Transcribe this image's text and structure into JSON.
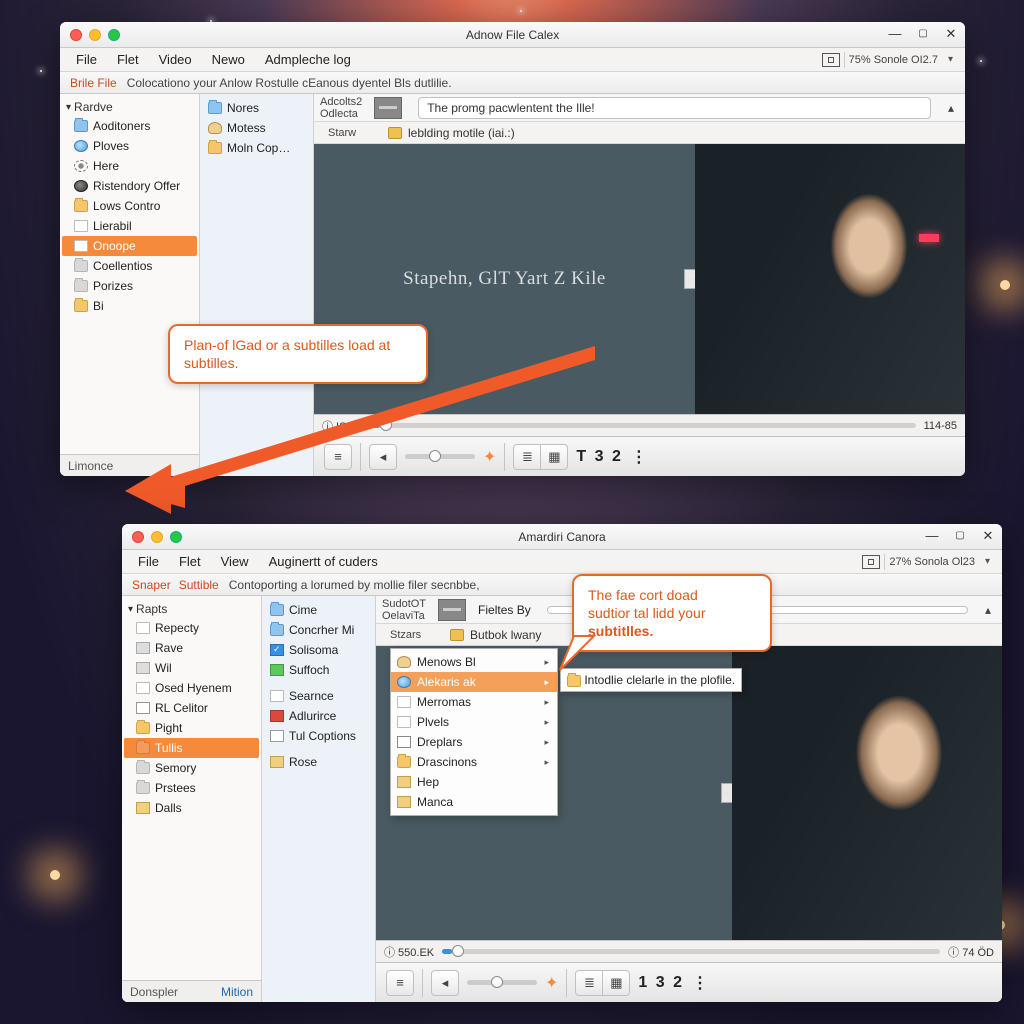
{
  "win1": {
    "title": "Adnow File Calex",
    "menus": [
      "File",
      "Flet",
      "Video",
      "Newo",
      "Admpleche log"
    ],
    "battery": "75% Sonole OI2.7",
    "toolbar2": {
      "link": "Brile File",
      "desc": "Colocationo your Anlow Rostulle cEanous dyentel Bls dutlilie."
    },
    "sidebar": {
      "header": "Rardve",
      "items": [
        {
          "icon": "folder blue",
          "label": "Aoditoners"
        },
        {
          "icon": "globe",
          "label": "Ploves"
        },
        {
          "icon": "gear",
          "label": "Here"
        },
        {
          "icon": "darkglobe",
          "label": "Ristendory Offer"
        },
        {
          "icon": "folder",
          "label": "Lows Contro"
        },
        {
          "icon": "page",
          "label": "Lierabil"
        },
        {
          "icon": "page",
          "label": "Onoope",
          "selected": true
        },
        {
          "icon": "folder grey",
          "label": "Coellentios"
        },
        {
          "icon": "folder grey",
          "label": "Porizes"
        },
        {
          "icon": "folder",
          "label": "Bi"
        }
      ],
      "status": "Limonce"
    },
    "midcol": [
      {
        "icon": "folder blue",
        "label": "Nores"
      },
      {
        "icon": "person",
        "label": "Motess"
      },
      {
        "icon": "folder",
        "label": "Moln Cop…"
      }
    ],
    "info": {
      "lines": [
        "Adcolts2",
        "Odlecta",
        "Starw"
      ],
      "message": "The promg pacwlentent the Ille!",
      "subline": "leblding motile (iai.:)"
    },
    "overlay_text": "Stapehn, GlT Yart Z Kile",
    "seek": {
      "left_time": "ⓘ IS6O",
      "pos_pct": 2,
      "right_time": "114-85"
    },
    "counter": "T 3 2"
  },
  "win2": {
    "title": "Amardiri Canora",
    "menus": [
      "File",
      "Flet",
      "View",
      "Auginertt of cuders"
    ],
    "battery": "27% Sonola Ol23",
    "toolbar2": {
      "link1": "Snaper",
      "link2": "Suttible",
      "desc": "Contoporting a lorumed by mollie filer secnbbe,"
    },
    "sidebar": {
      "header": "Rapts",
      "items": [
        {
          "icon": "page",
          "label": "Repecty"
        },
        {
          "icon": "disk",
          "label": "Rave"
        },
        {
          "icon": "disk",
          "label": "Wil"
        },
        {
          "icon": "page",
          "label": "Osed Hyenem"
        },
        {
          "icon": "text",
          "label": "RL Celitor"
        },
        {
          "icon": "folder",
          "label": "Pight"
        },
        {
          "icon": "folder orange",
          "label": "Tullis",
          "selected": true
        },
        {
          "icon": "folder grey",
          "label": "Semory"
        },
        {
          "icon": "folder grey",
          "label": "Prstees"
        },
        {
          "icon": "pic",
          "label": "Dalls"
        }
      ],
      "status": "Donspler",
      "status_right": "Mition"
    },
    "midcol": [
      {
        "icon": "folder blue",
        "label": "Cime"
      },
      {
        "icon": "folder blue",
        "label": "Concrher Mi"
      },
      {
        "icon": "bluecheck",
        "label": "Solisoma"
      },
      {
        "icon": "green",
        "label": "Suffoch"
      },
      {
        "icon": "page",
        "label": "Searnce"
      },
      {
        "icon": "red",
        "label": "Adlurirce"
      },
      {
        "icon": "text",
        "label": "Tul Coptions"
      },
      {
        "icon": "pic",
        "label": "Rose"
      }
    ],
    "info": {
      "lines": [
        "SudotOT",
        "OelaviTa",
        "Stzars"
      ],
      "message_prefix": "Fieltes By",
      "subline": "Butbok lwany"
    },
    "context_menu": [
      {
        "icon": "person",
        "label": "Menows Bl",
        "arrow": true
      },
      {
        "icon": "globe",
        "label": "Alekaris ak",
        "arrow": true,
        "selected": true
      },
      {
        "icon": "page",
        "label": "Merromas",
        "arrow": true
      },
      {
        "icon": "page",
        "label": "Plvels",
        "arrow": true
      },
      {
        "icon": "sub",
        "label": "Dreplars",
        "arrow": true
      },
      {
        "icon": "folder",
        "label": "Drascinons",
        "arrow": true
      },
      {
        "icon": "pic",
        "label": "Hep"
      },
      {
        "icon": "pic",
        "label": "Manca"
      }
    ],
    "submenu_text": "Intodlie clelarle in the plofile.",
    "seek": {
      "left_time": "ⓘ 550.EK",
      "pos_pct": 2,
      "right_time": "ⓘ 74 ÖD"
    },
    "counter": "1 3 2"
  },
  "callout1": "Plan-of lGad or a subtilles load at subtilles.",
  "callout2_lines": [
    "The fae cort doad",
    "sudtior tal lidd your",
    "subtitlles."
  ]
}
